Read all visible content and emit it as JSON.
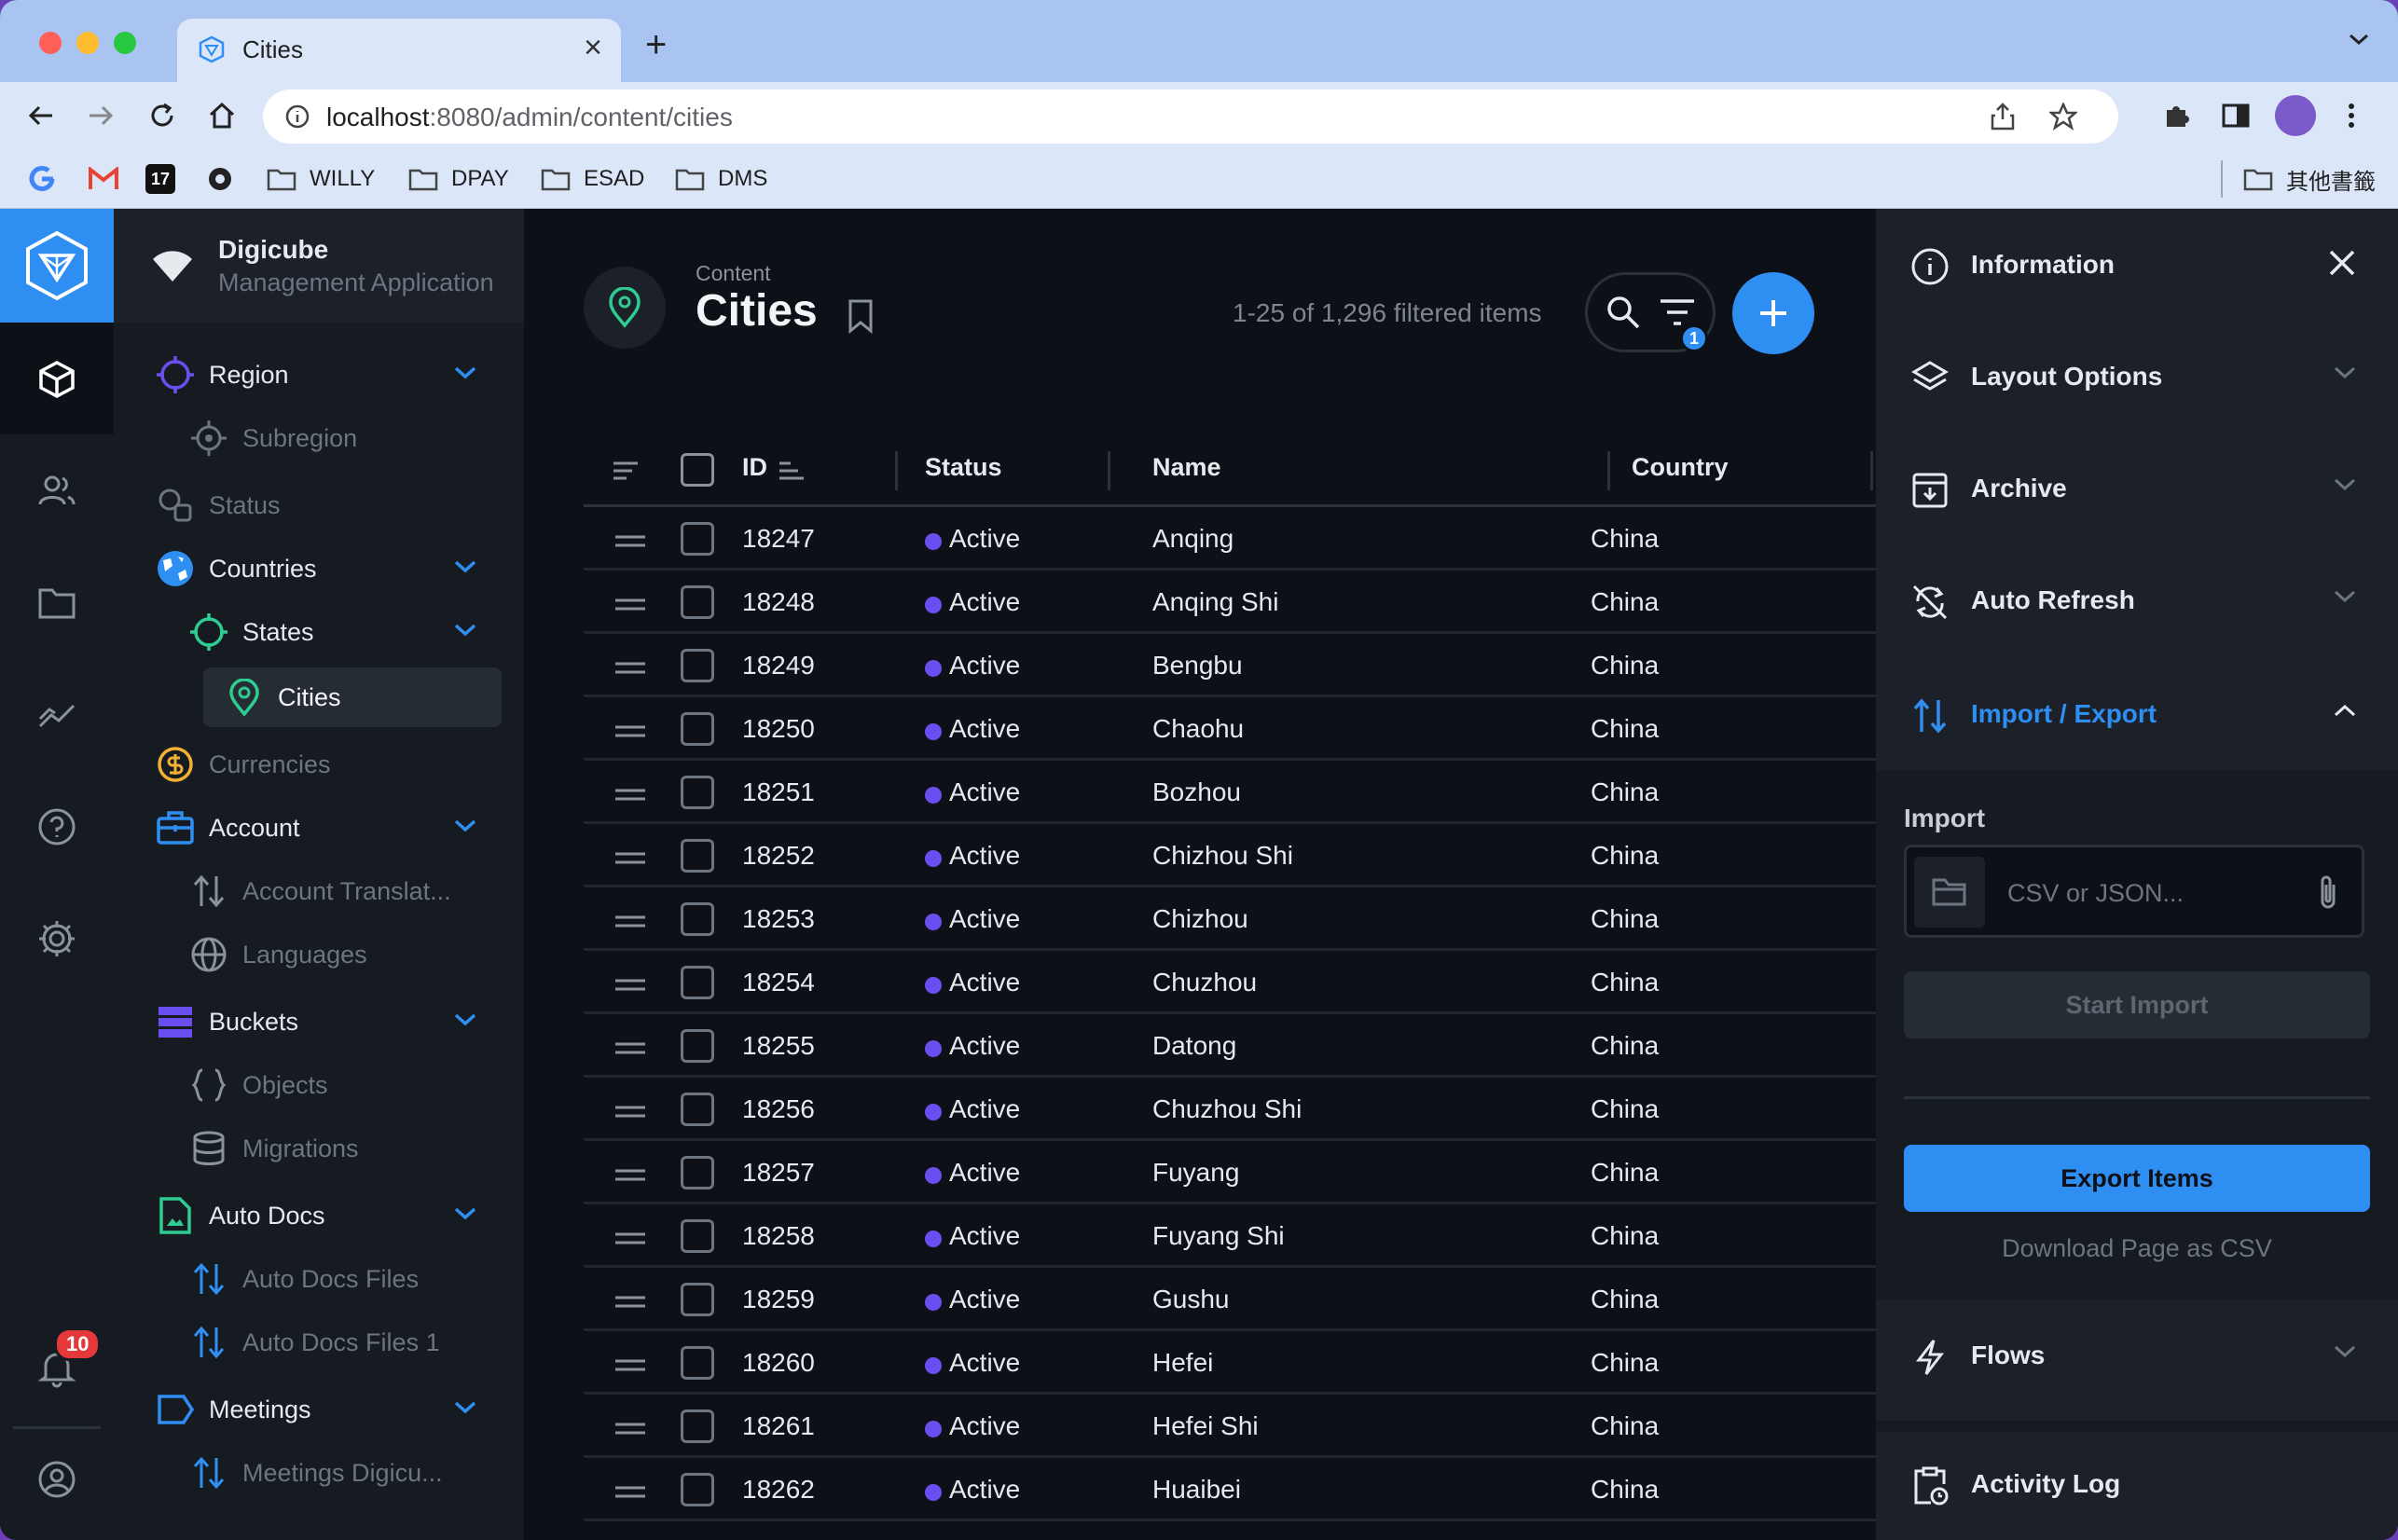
{
  "browser": {
    "tab_title": "Cities",
    "url_host": "localhost",
    "url_path": ":8080/admin/content/cities",
    "bookmarks": [
      "WILLY",
      "DPAY",
      "ESAD",
      "DMS"
    ],
    "other_bookmarks": "其他書籤"
  },
  "project": {
    "name": "Digicube",
    "subtitle": "Management Application"
  },
  "notifications": {
    "count": "10"
  },
  "nav": {
    "region": "Region",
    "subregion": "Subregion",
    "status": "Status",
    "countries": "Countries",
    "states": "States",
    "cities": "Cities",
    "currencies": "Currencies",
    "account": "Account",
    "account_translations": "Account Translat...",
    "languages": "Languages",
    "buckets": "Buckets",
    "objects": "Objects",
    "migrations": "Migrations",
    "auto_docs": "Auto Docs",
    "auto_docs_files": "Auto Docs Files",
    "auto_docs_files_1": "Auto Docs Files 1",
    "meetings": "Meetings",
    "meetings_digicube": "Meetings Digicu..."
  },
  "header": {
    "breadcrumb": "Content",
    "title": "Cities",
    "count": "1-25 of 1,296 filtered items",
    "filter_count": "1"
  },
  "table": {
    "columns": {
      "id": "ID",
      "status": "Status",
      "name": "Name",
      "country": "Country"
    },
    "rows": [
      {
        "id": "18247",
        "status": "Active",
        "name": "Anqing",
        "country": "China"
      },
      {
        "id": "18248",
        "status": "Active",
        "name": "Anqing Shi",
        "country": "China"
      },
      {
        "id": "18249",
        "status": "Active",
        "name": "Bengbu",
        "country": "China"
      },
      {
        "id": "18250",
        "status": "Active",
        "name": "Chaohu",
        "country": "China"
      },
      {
        "id": "18251",
        "status": "Active",
        "name": "Bozhou",
        "country": "China"
      },
      {
        "id": "18252",
        "status": "Active",
        "name": "Chizhou Shi",
        "country": "China"
      },
      {
        "id": "18253",
        "status": "Active",
        "name": "Chizhou",
        "country": "China"
      },
      {
        "id": "18254",
        "status": "Active",
        "name": "Chuzhou",
        "country": "China"
      },
      {
        "id": "18255",
        "status": "Active",
        "name": "Datong",
        "country": "China"
      },
      {
        "id": "18256",
        "status": "Active",
        "name": "Chuzhou Shi",
        "country": "China"
      },
      {
        "id": "18257",
        "status": "Active",
        "name": "Fuyang",
        "country": "China"
      },
      {
        "id": "18258",
        "status": "Active",
        "name": "Fuyang Shi",
        "country": "China"
      },
      {
        "id": "18259",
        "status": "Active",
        "name": "Gushu",
        "country": "China"
      },
      {
        "id": "18260",
        "status": "Active",
        "name": "Hefei",
        "country": "China"
      },
      {
        "id": "18261",
        "status": "Active",
        "name": "Hefei Shi",
        "country": "China"
      },
      {
        "id": "18262",
        "status": "Active",
        "name": "Huaibei",
        "country": "China"
      }
    ]
  },
  "sidebar": {
    "information": "Information",
    "layout_options": "Layout Options",
    "archive": "Archive",
    "auto_refresh": "Auto Refresh",
    "import_export": "Import / Export",
    "import_label": "Import",
    "import_placeholder": "CSV or JSON...",
    "start_import": "Start Import",
    "export_items": "Export Items",
    "download_csv": "Download Page as CSV",
    "flows": "Flows",
    "activity_log": "Activity Log"
  },
  "colors": {
    "accent": "#2f8ef2",
    "status_active": "#6b4ef0",
    "background": "#0d1117"
  }
}
